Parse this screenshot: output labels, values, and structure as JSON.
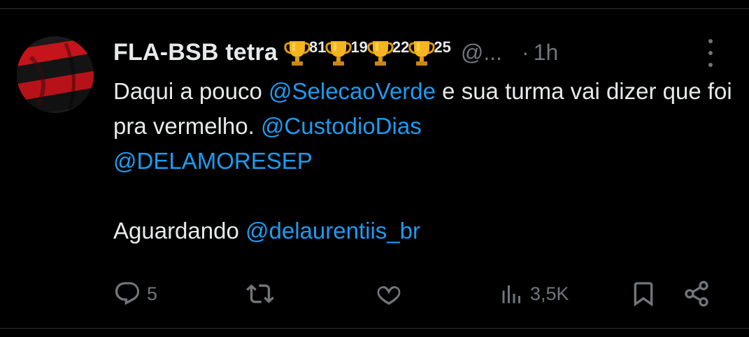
{
  "post": {
    "display_name": "FLA-BSB tetra",
    "name_badges": [
      {
        "icon": "trophy-icon",
        "number": "81"
      },
      {
        "icon": "trophy-icon",
        "number": "19"
      },
      {
        "icon": "trophy-icon",
        "number": "22"
      },
      {
        "icon": "trophy-icon",
        "number": "25"
      }
    ],
    "handle": "@...",
    "separator": "·",
    "time": "1h",
    "body": {
      "line1_text": "Daqui a pouco ",
      "mention1": "@SelecaoVerde",
      "line1_rest": " e sua turma vai dizer que foi pra vermelho. ",
      "mention2": "@CustodioDias",
      "mention3": "@DELAMORESEP",
      "para2_text": "Aguardando ",
      "mention4": "@delaurentiis_br"
    },
    "actions": {
      "reply_count": "5",
      "retweet_count": "",
      "like_count": "",
      "views_count": "3,5K"
    }
  },
  "colors": {
    "background": "#000000",
    "text": "#e7e9ea",
    "muted": "#71767b",
    "mention": "#1d9bf0",
    "divider": "#2f3336"
  },
  "icons": {
    "avatar": "flag-avatar",
    "reply": "reply-icon",
    "retweet": "retweet-icon",
    "like": "heart-icon",
    "views": "views-icon",
    "bookmark": "bookmark-icon",
    "share": "share-icon",
    "more": "more-vertical-icon"
  }
}
